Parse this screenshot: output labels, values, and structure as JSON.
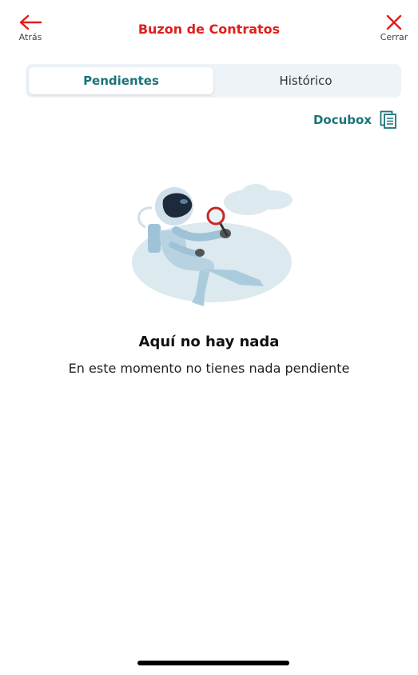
{
  "header": {
    "title": "Buzon de Contratos",
    "back_label": "Atrás",
    "close_label": "Cerrar"
  },
  "tabs": [
    {
      "label": "Pendientes",
      "active": true
    },
    {
      "label": "Histórico",
      "active": false
    }
  ],
  "docubox": {
    "label": "Docubox",
    "icon": "documents-icon"
  },
  "empty_state": {
    "title": "Aquí no hay nada",
    "subtitle": "En este momento no tienes nada pendiente",
    "illustration": "astronaut-magnifier-illustration"
  },
  "colors": {
    "accent_red": "#e0201b",
    "teal": "#1a7379",
    "tab_bg": "#eef3f7"
  }
}
